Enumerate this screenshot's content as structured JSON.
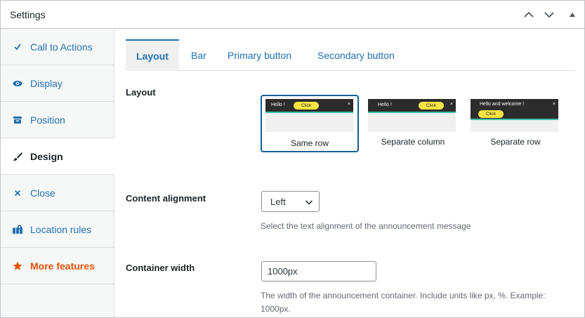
{
  "panel": {
    "title": "Settings"
  },
  "sidebar": {
    "items": [
      {
        "label": "Call to Actions",
        "icon": "checkmark-icon"
      },
      {
        "label": "Display",
        "icon": "eye-icon"
      },
      {
        "label": "Position",
        "icon": "archive-icon"
      },
      {
        "label": "Design",
        "icon": "brush-icon"
      },
      {
        "label": "Close",
        "icon": "close-icon"
      },
      {
        "label": "Location rules",
        "icon": "location-icon"
      },
      {
        "label": "More features",
        "icon": "star-icon"
      }
    ],
    "active": "Design"
  },
  "tabs": [
    {
      "label": "Layout"
    },
    {
      "label": "Bar"
    },
    {
      "label": "Primary button"
    },
    {
      "label": "Secondary button"
    }
  ],
  "layout": {
    "label": "Layout",
    "options": [
      {
        "caption": "Same row",
        "preview_text": "Hello !",
        "preview_button": "Click",
        "preview_close": "×"
      },
      {
        "caption": "Separate column",
        "preview_text": "Hello !",
        "preview_button": "Click",
        "preview_close": "×"
      },
      {
        "caption": "Separate row",
        "preview_text": "Hello and welcome !",
        "preview_button": "Click",
        "preview_close": "×"
      }
    ],
    "selected": "Same row"
  },
  "content_alignment": {
    "label": "Content alignment",
    "value": "Left",
    "help": "Select the text alignment of the announcement message"
  },
  "container_width": {
    "label": "Container width",
    "value": "1000px",
    "help_line1": "The width of the announcement container. Include units like px, %. Example:",
    "help_line2": "1000px."
  },
  "colors": {
    "accent": "#2271b1",
    "more_features": "#e5540a",
    "preview_bar": "#2c2c2c",
    "preview_button": "#f6e443",
    "preview_border": "#3fbfa8"
  }
}
